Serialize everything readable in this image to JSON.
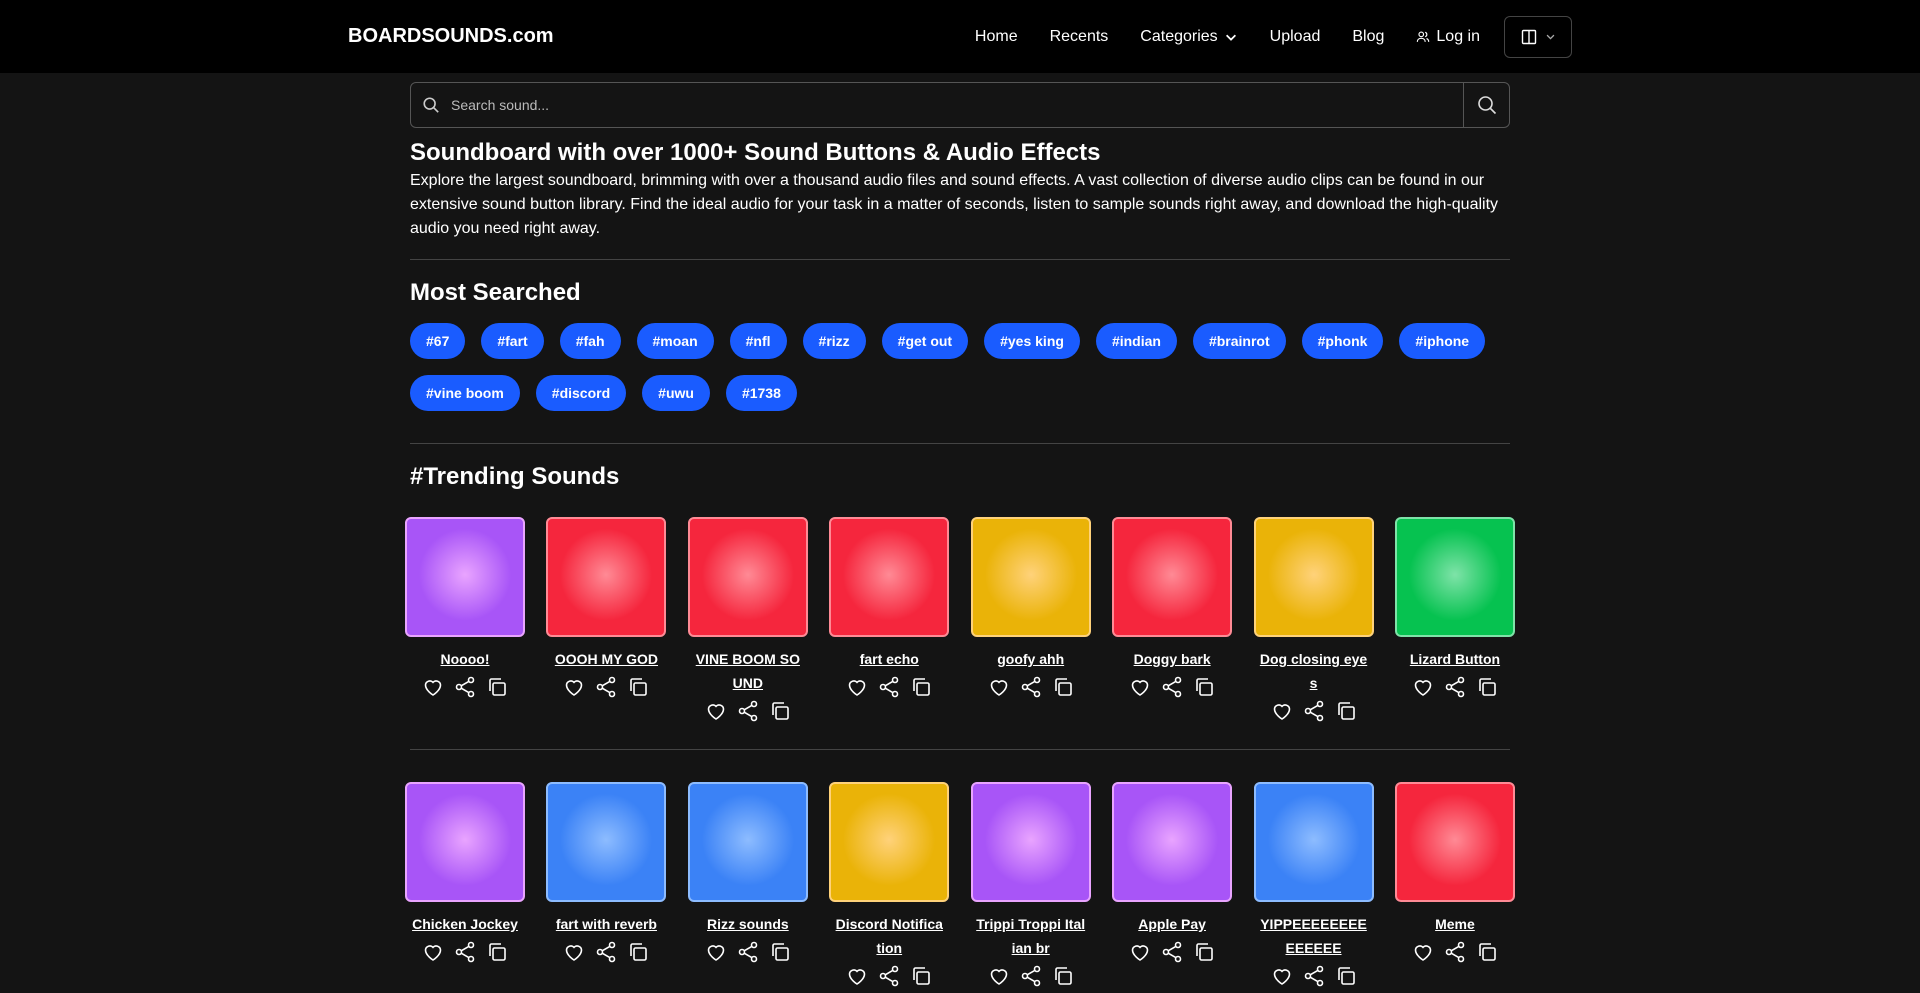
{
  "header": {
    "brand": "BOARDSOUNDS.com",
    "nav": [
      "Home",
      "Recents",
      "Categories",
      "Upload",
      "Blog"
    ],
    "login": "Log in"
  },
  "search": {
    "placeholder": "Search sound..."
  },
  "intro": {
    "title": "Soundboard with over 1000+ Sound Buttons & Audio Effects",
    "text": "Explore the largest soundboard, brimming with over a thousand audio files and sound effects. A vast collection of diverse audio clips can be found in our extensive sound button library. Find the ideal audio for your task in a matter of seconds, listen to sample sounds right away, and download the high-quality audio you need right away."
  },
  "most_searched": {
    "title": "Most Searched",
    "tags": [
      "#67",
      "#fart",
      "#fah",
      "#moan",
      "#nfl",
      "#rizz",
      "#get out",
      "#yes king",
      "#indian",
      "#brainrot",
      "#phonk",
      "#iphone",
      "#vine boom",
      "#discord",
      "#uwu",
      "#1738"
    ]
  },
  "trending": {
    "title": "#Trending Sounds",
    "rows": [
      [
        {
          "title": "Noooo!",
          "color": "purple"
        },
        {
          "title": "OOOH MY GOD",
          "color": "red"
        },
        {
          "title": "VINE BOOM SOUND",
          "color": "red"
        },
        {
          "title": "fart echo",
          "color": "red"
        },
        {
          "title": "goofy ahh",
          "color": "yellow"
        },
        {
          "title": "Doggy bark",
          "color": "red"
        },
        {
          "title": "Dog closing eyes",
          "color": "yellow"
        },
        {
          "title": "Lizard Button",
          "color": "green"
        }
      ],
      [
        {
          "title": "Chicken Jockey",
          "color": "purple"
        },
        {
          "title": "fart with reverb",
          "color": "blue"
        },
        {
          "title": "Rizz sounds",
          "color": "blue"
        },
        {
          "title": "Discord Notification",
          "color": "yellow"
        },
        {
          "title": "Trippi Troppi Italian br",
          "color": "purple"
        },
        {
          "title": "Apple Pay",
          "color": "purple"
        },
        {
          "title": "YIPPEEEEEEEEEEEEEE",
          "color": "blue"
        },
        {
          "title": "Meme",
          "color": "red"
        }
      ]
    ]
  },
  "colors": {
    "purple": [
      "#e9a4ff",
      "#a855f7"
    ],
    "red": [
      "#ff8a95",
      "#f5263d"
    ],
    "yellow": [
      "#ffd27a",
      "#eab308"
    ],
    "green": [
      "#7ee3a8",
      "#06c250"
    ],
    "blue": [
      "#8dbcff",
      "#3b82f6"
    ],
    "tag_bg": "#1a5cff"
  }
}
